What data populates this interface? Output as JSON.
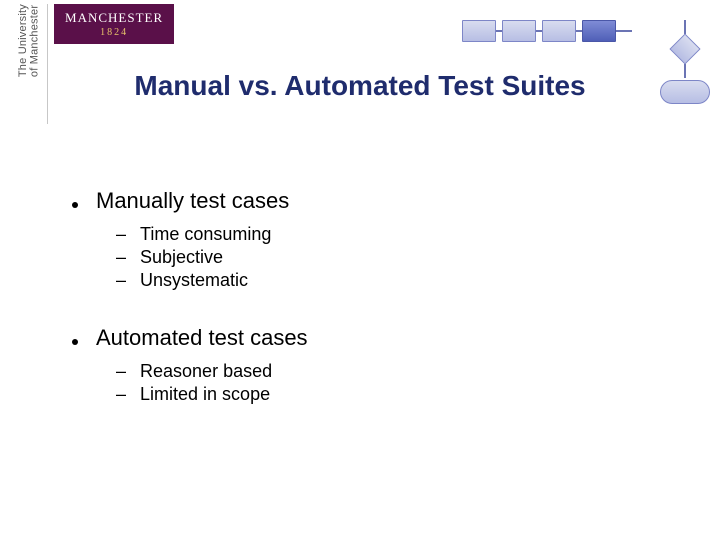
{
  "logo": {
    "wordmark": "MANCHESTER",
    "year": "1824",
    "vertical_line1": "The University",
    "vertical_line2": "of Manchester"
  },
  "title": "Manual vs. Automated Test Suites",
  "sections": [
    {
      "heading": "Manually test cases",
      "items": [
        "Time consuming",
        "Subjective",
        "Unsystematic"
      ]
    },
    {
      "heading": "Automated test cases",
      "items": [
        "Reasoner based",
        "Limited in scope"
      ]
    }
  ]
}
